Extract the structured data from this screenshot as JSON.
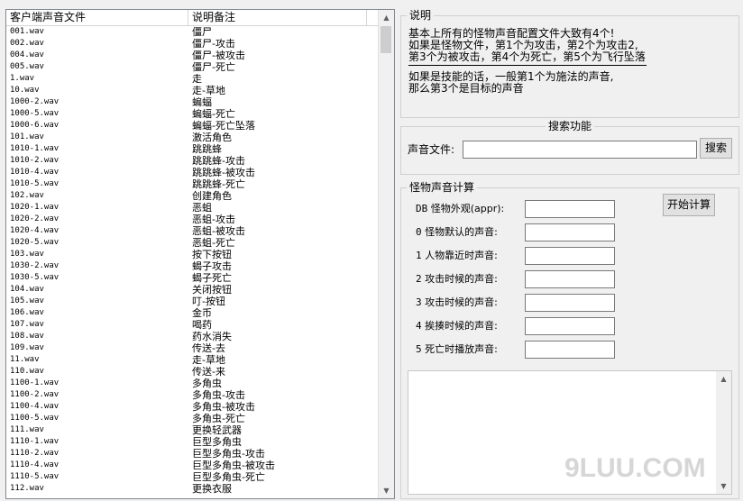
{
  "list": {
    "columns": [
      "客户端声音文件",
      "说明备注"
    ],
    "rows": [
      [
        "001.wav",
        "僵尸"
      ],
      [
        "002.wav",
        "僵尸-攻击"
      ],
      [
        "004.wav",
        "僵尸-被攻击"
      ],
      [
        "005.wav",
        "僵尸-死亡"
      ],
      [
        "1.wav",
        "走"
      ],
      [
        "10.wav",
        "走-草地"
      ],
      [
        "1000-2.wav",
        "蝙蝠"
      ],
      [
        "1000-5.wav",
        "蝙蝠-死亡"
      ],
      [
        "1000-6.wav",
        "蝙蝠-死亡坠落"
      ],
      [
        "101.wav",
        "激活角色"
      ],
      [
        "1010-1.wav",
        "跳跳蜂"
      ],
      [
        "1010-2.wav",
        "跳跳蜂-攻击"
      ],
      [
        "1010-4.wav",
        "跳跳蜂-被攻击"
      ],
      [
        "1010-5.wav",
        "跳跳蜂-死亡"
      ],
      [
        "102.wav",
        "创建角色"
      ],
      [
        "1020-1.wav",
        "恶蛆"
      ],
      [
        "1020-2.wav",
        "恶蛆-攻击"
      ],
      [
        "1020-4.wav",
        "恶蛆-被攻击"
      ],
      [
        "1020-5.wav",
        "恶蛆-死亡"
      ],
      [
        "103.wav",
        "按下按钮"
      ],
      [
        "1030-2.wav",
        "蝎子攻击"
      ],
      [
        "1030-5.wav",
        "蝎子死亡"
      ],
      [
        "104.wav",
        "关闭按钮"
      ],
      [
        "105.wav",
        "叮-按钮"
      ],
      [
        "106.wav",
        "金币"
      ],
      [
        "107.wav",
        "喝药"
      ],
      [
        "108.wav",
        "药水消失"
      ],
      [
        "109.wav",
        "传送-去"
      ],
      [
        "11.wav",
        "走-草地"
      ],
      [
        "110.wav",
        "传送-来"
      ],
      [
        "1100-1.wav",
        "多角虫"
      ],
      [
        "1100-2.wav",
        "多角虫-攻击"
      ],
      [
        "1100-4.wav",
        "多角虫-被攻击"
      ],
      [
        "1100-5.wav",
        "多角虫-死亡"
      ],
      [
        "111.wav",
        "更换轻武器"
      ],
      [
        "1110-1.wav",
        "巨型多角虫"
      ],
      [
        "1110-2.wav",
        "巨型多角虫-攻击"
      ],
      [
        "1110-4.wav",
        "巨型多角虫-被攻击"
      ],
      [
        "1110-5.wav",
        "巨型多角虫-死亡"
      ],
      [
        "112.wav",
        "更换衣服"
      ]
    ]
  },
  "info": {
    "legend": "说明",
    "line1": "基本上所有的怪物声音配置文件大致有4个!",
    "line2": "如果是怪物文件，第1个为攻击，第2个为攻击2,",
    "line3": "第3个为被攻击，第4个为死亡，第5个为飞行坠落",
    "line4": "如果是技能的话，一般第1个为施法的声音,",
    "line5": "那么第3个是目标的声音"
  },
  "search": {
    "legend": "搜索功能",
    "label": "声音文件:",
    "value": "",
    "button": "搜索"
  },
  "calc": {
    "legend": "怪物声音计算",
    "start_button": "开始计算",
    "fields": [
      {
        "lead": "DB",
        "label": "怪物外观(appr):",
        "value": ""
      },
      {
        "lead": "0",
        "label": "怪物默认的声音:",
        "value": ""
      },
      {
        "lead": "1",
        "label": "人物靠近时声音:",
        "value": ""
      },
      {
        "lead": "2",
        "label": "攻击时候的声音:",
        "value": ""
      },
      {
        "lead": "3",
        "label": "攻击时候的声音:",
        "value": ""
      },
      {
        "lead": "4",
        "label": "挨揍时候的声音:",
        "value": ""
      },
      {
        "lead": "5",
        "label": "死亡时播放声音:",
        "value": ""
      }
    ]
  },
  "watermark": "9LUU.COM"
}
